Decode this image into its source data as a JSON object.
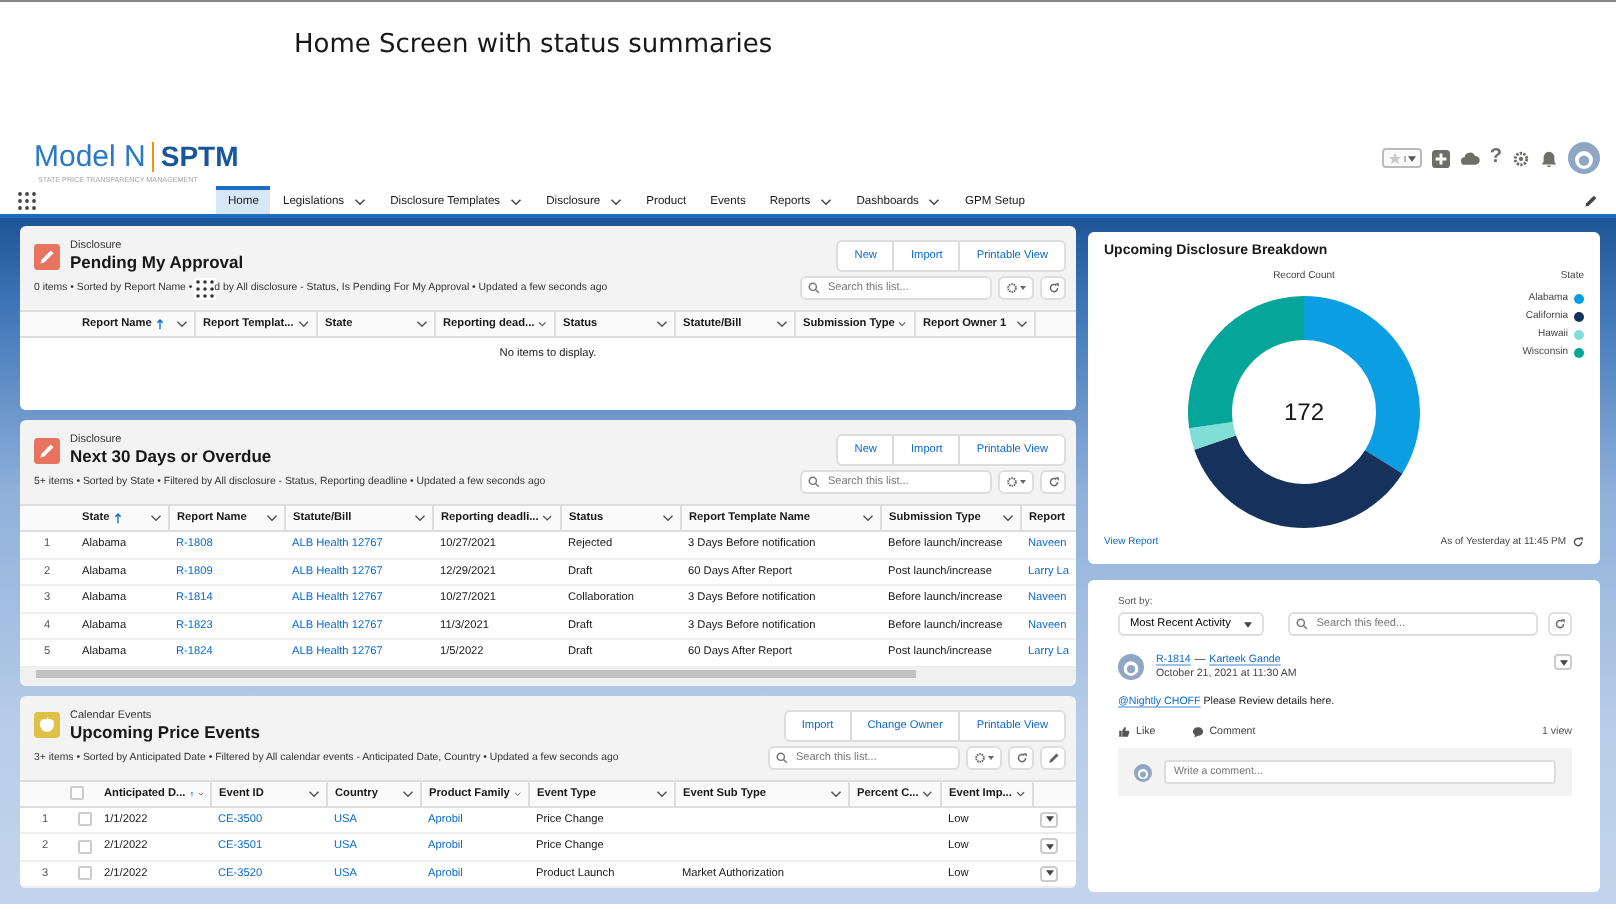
{
  "caption": "Home Screen with status summaries",
  "app": {
    "logo_left": "Model N",
    "logo_right": "SPTM",
    "subtitle": "STATE PRICE TRANSPARENCY MANAGEMENT",
    "help": "?"
  },
  "nav": [
    {
      "label": "Home",
      "selected": true
    },
    {
      "label": "Legislations",
      "selected": false,
      "menu": true
    },
    {
      "label": "Disclosure Templates",
      "selected": false,
      "menu": true
    },
    {
      "label": "Disclosure",
      "selected": false,
      "menu": true
    },
    {
      "label": "Product",
      "selected": false
    },
    {
      "label": "Events",
      "selected": false
    },
    {
      "label": "Reports",
      "selected": false,
      "menu": true
    },
    {
      "label": "Dashboards",
      "selected": false,
      "menu": true
    },
    {
      "label": "GPM Setup",
      "selected": false
    }
  ],
  "lists": [
    {
      "kind": "disclosure",
      "object": "Disclosure",
      "title": "Pending My Approval",
      "meta": "0 items • Sorted by Report Name •",
      "meta_rest": "d by All disclosure - Status, Is Pending For My Approval • Updated a few seconds ago",
      "actions": [
        "New",
        "Import",
        "Printable View"
      ],
      "search": {
        "placeholder": "Search this list..."
      },
      "columns": [
        {
          "label": "Report Name",
          "sorted": true
        },
        {
          "label": "Report Templat..."
        },
        {
          "label": "State"
        },
        {
          "label": "Reporting dead..."
        },
        {
          "label": "Status"
        },
        {
          "label": "Statute/Bill"
        },
        {
          "label": "Submission Type"
        },
        {
          "label": "Report Owner 1"
        }
      ],
      "empty_text": "No items to display."
    },
    {
      "kind": "disclosure",
      "object": "Disclosure",
      "title": "Next 30 Days or Overdue",
      "meta": "5+ items • Sorted by State • Filtered by All disclosure - Status, Reporting deadline • Updated a few seconds ago",
      "actions": [
        "New",
        "Import",
        "Printable View"
      ],
      "search": {
        "placeholder": "Search this list..."
      },
      "scrollbar": true,
      "columns": [
        {
          "label": "State",
          "sorted": true
        },
        {
          "label": "Report Name",
          "link": true
        },
        {
          "label": "Statute/Bill",
          "link": true
        },
        {
          "label": "Reporting deadli..."
        },
        {
          "label": "Status"
        },
        {
          "label": "Report Template Name"
        },
        {
          "label": "Submission Type"
        },
        {
          "label": "Report",
          "link": true,
          "menu": false
        }
      ],
      "rows": [
        {
          "number": "1",
          "cells": [
            "Alabama",
            "R-1808",
            "ALB Health 12767",
            "10/27/2021",
            "Rejected",
            "3 Days Before notification",
            "Before launch/increase",
            "Naveen"
          ]
        },
        {
          "number": "2",
          "cells": [
            "Alabama",
            "R-1809",
            "ALB Health 12767",
            "12/29/2021",
            "Draft",
            "60 Days After Report",
            "Post launch/increase",
            "Larry La"
          ]
        },
        {
          "number": "3",
          "cells": [
            "Alabama",
            "R-1814",
            "ALB Health 12767",
            "10/27/2021",
            "Collaboration",
            "3 Days Before notification",
            "Before launch/increase",
            "Naveen"
          ]
        },
        {
          "number": "4",
          "cells": [
            "Alabama",
            "R-1823",
            "ALB Health 12767",
            "11/3/2021",
            "Draft",
            "3 Days Before notification",
            "Before launch/increase",
            "Naveen"
          ]
        },
        {
          "number": "5",
          "cells": [
            "Alabama",
            "R-1824",
            "ALB Health 12767",
            "1/5/2022",
            "Draft",
            "60 Days After Report",
            "Post launch/increase",
            "Larry La"
          ]
        }
      ]
    },
    {
      "kind": "calendar",
      "object": "Calendar Events",
      "title": "Upcoming Price Events",
      "meta": "3+ items • Sorted by Anticipated Date • Filtered by All calendar events - Anticipated Date, Country • Updated a few seconds ago",
      "actions": [
        "Import",
        "Change Owner",
        "Printable View"
      ],
      "search": {
        "placeholder": "Search this list..."
      },
      "edit_button": true,
      "selectable": true,
      "select_all_checked": false,
      "row_menu": true,
      "columns": [
        {
          "label": "Anticipated D...",
          "sorted": true
        },
        {
          "label": "Event ID",
          "link": true
        },
        {
          "label": "Country",
          "link": true
        },
        {
          "label": "Product Family",
          "link": true
        },
        {
          "label": "Event Type"
        },
        {
          "label": "Event Sub Type"
        },
        {
          "label": "Percent C..."
        },
        {
          "label": "Event Imp..."
        }
      ],
      "rows": [
        {
          "number": "1",
          "checked": false,
          "cells": [
            "1/1/2022",
            "CE-3500",
            "USA",
            "Aprobil",
            "Price Change",
            null,
            null,
            "Low"
          ]
        },
        {
          "number": "2",
          "checked": false,
          "cells": [
            "2/1/2022",
            "CE-3501",
            "USA",
            "Aprobil",
            "Price Change",
            null,
            null,
            "Low"
          ]
        },
        {
          "number": "3",
          "checked": false,
          "cells": [
            "2/1/2022",
            "CE-3520",
            "USA",
            "Aprobil",
            "Product Launch",
            "Market Authorization",
            null,
            "Low"
          ]
        }
      ]
    }
  ],
  "breakdown": {
    "title": "Upcoming Disclosure Breakdown",
    "measure": "Record Count",
    "total": "172",
    "legend_title": "State",
    "legend": [
      {
        "label": "Alabama",
        "color": "#0b9ee3"
      },
      {
        "label": "California",
        "color": "#16325c"
      },
      {
        "label": "Hawaii",
        "color": "#7fdfd7"
      },
      {
        "label": "Wisconsin",
        "color": "#06a59a"
      }
    ],
    "link": "View Report",
    "updated": "As of Yesterday at 11:45 PM"
  },
  "feed": {
    "sort_label": "Sort by:",
    "sort_value": "Most Recent Activity",
    "search": {
      "placeholder": "Search this feed..."
    },
    "post": {
      "record": "R-1814",
      "separator": "—",
      "author": "Karteek Gande",
      "date": "October 21, 2021 at 11:30 AM",
      "mention": "@Nightly CHOFF",
      "body": "Please Review details here.",
      "like": "Like",
      "comment": "Comment",
      "views": "1 view"
    },
    "comment_box": {
      "placeholder": "Write a comment..."
    }
  }
}
